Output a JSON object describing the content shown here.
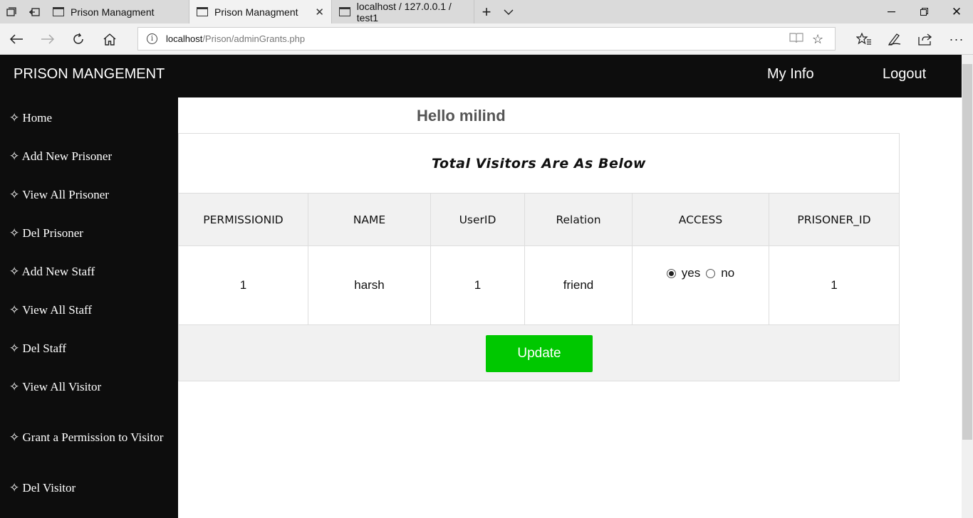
{
  "browser": {
    "tabs": [
      {
        "title": "Prison Managment",
        "active": false
      },
      {
        "title": "Prison Managment",
        "active": true
      },
      {
        "title": "localhost / 127.0.0.1 / test1",
        "active": false
      }
    ],
    "address": {
      "host": "localhost",
      "path": "/Prison/adminGrants.php"
    },
    "icons": {
      "tab_preview": "tab-preview-icon",
      "set_aside": "set-aside-tabs-icon",
      "new_tab": "plus-icon",
      "tab_list": "chevron-down-icon",
      "back": "back-arrow-icon",
      "forward": "forward-arrow-icon",
      "refresh": "refresh-icon",
      "home": "home-icon",
      "info": "info-icon",
      "reading_view": "book-icon",
      "favorite": "star-icon",
      "favorites_hub": "favorites-list-icon",
      "notes": "pen-icon",
      "share": "share-icon",
      "more": "more-icon"
    }
  },
  "header": {
    "brand": "PRISON MANGEMENT",
    "links": [
      "My Info",
      "Logout"
    ]
  },
  "sidebar": {
    "bullet": "✧",
    "items": [
      "Home",
      "Add New Prisoner",
      "View All Prisoner",
      "Del Prisoner",
      "Add New Staff",
      "View All Staff",
      "Del Staff",
      "View All Visitor",
      "Grant a Permission to Visitor",
      "Del Visitor"
    ]
  },
  "main": {
    "greeting": "Hello milind",
    "table": {
      "caption": "Total Visitors Are As Below",
      "columns": [
        "PERMISSIONID",
        "NAME",
        "UserID",
        "Relation",
        "ACCESS",
        "PRISONER_ID"
      ],
      "rows": [
        {
          "permission_id": "1",
          "name": "harsh",
          "user_id": "1",
          "relation": "friend",
          "access_options": [
            "yes",
            "no"
          ],
          "access_selected": "yes",
          "prisoner_id": "1"
        }
      ]
    },
    "update_label": "Update",
    "colors": {
      "update_button": "#00c800",
      "header_bg": "#0d0d0d"
    }
  }
}
